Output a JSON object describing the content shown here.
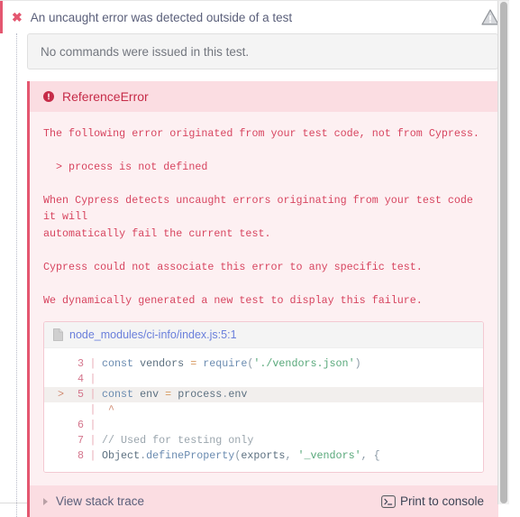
{
  "test": {
    "fail_icon": "x-mark-icon",
    "title": "An uncaught error was detected outside of a test",
    "warning_icon": "warning-triangle-icon",
    "no_commands_text": "No commands were issued in this test."
  },
  "error": {
    "icon": "error-circle-icon",
    "name": "ReferenceError",
    "lines": [
      "The following error originated from your test code, not from Cypress.",
      "",
      "  > process is not defined",
      "",
      "When Cypress detects uncaught errors originating from your test code it will",
      "automatically fail the current test.",
      "",
      "Cypress could not associate this error to any specific test.",
      "",
      "We dynamically generated a new test to display this failure."
    ]
  },
  "code_frame": {
    "file_icon": "file-document-icon",
    "file_path": "node_modules/ci-info/index.js:5:1",
    "rows": [
      {
        "marker": "",
        "number": "3",
        "bar": "|",
        "highlight": false,
        "tokens": [
          {
            "t": "const",
            "c": "tok-kw"
          },
          {
            "t": " vendors",
            "c": "tok-var"
          },
          {
            "t": " = ",
            "c": "tok-op"
          },
          {
            "t": "require",
            "c": "tok-fn"
          },
          {
            "t": "(",
            "c": "tok-punc"
          },
          {
            "t": "'./vendors.json'",
            "c": "tok-str"
          },
          {
            "t": ")",
            "c": "tok-punc"
          }
        ]
      },
      {
        "marker": "",
        "number": "4",
        "bar": "|",
        "highlight": false,
        "tokens": []
      },
      {
        "marker": ">",
        "number": "5",
        "bar": "|",
        "highlight": true,
        "tokens": [
          {
            "t": "const",
            "c": "tok-kw"
          },
          {
            "t": " env",
            "c": "tok-var"
          },
          {
            "t": " = ",
            "c": "tok-op"
          },
          {
            "t": "process",
            "c": "tok-var"
          },
          {
            "t": ".",
            "c": "tok-punc"
          },
          {
            "t": "env",
            "c": "tok-prop"
          }
        ]
      },
      {
        "marker": "",
        "number": "",
        "bar": "|",
        "highlight": false,
        "tokens": [
          {
            "t": " ^",
            "c": "tok-caret"
          }
        ]
      },
      {
        "marker": "",
        "number": "6",
        "bar": "|",
        "highlight": false,
        "tokens": []
      },
      {
        "marker": "",
        "number": "7",
        "bar": "|",
        "highlight": false,
        "tokens": [
          {
            "t": "// Used for testing only",
            "c": "tok-comment"
          }
        ]
      },
      {
        "marker": "",
        "number": "8",
        "bar": "|",
        "highlight": false,
        "tokens": [
          {
            "t": "Object",
            "c": "tok-var"
          },
          {
            "t": ".",
            "c": "tok-punc"
          },
          {
            "t": "defineProperty",
            "c": "tok-fn"
          },
          {
            "t": "(",
            "c": "tok-punc"
          },
          {
            "t": "exports",
            "c": "tok-var"
          },
          {
            "t": ", ",
            "c": "tok-punc"
          },
          {
            "t": "'_vendors'",
            "c": "tok-str"
          },
          {
            "t": ", ",
            "c": "tok-punc"
          },
          {
            "t": "{",
            "c": "tok-punc"
          }
        ]
      }
    ]
  },
  "footer": {
    "stack_caret_icon": "caret-right-icon",
    "stack_label": "View stack trace",
    "terminal_icon": "terminal-prompt-icon",
    "print_label": "Print to console"
  },
  "colors": {
    "accent_red": "#e45770",
    "error_text": "#d7445f",
    "error_name": "#c62b48",
    "panel_bg": "#fdf0f2",
    "panel_head_bg": "#fbdde2",
    "link_blue": "#6a7fdb"
  }
}
